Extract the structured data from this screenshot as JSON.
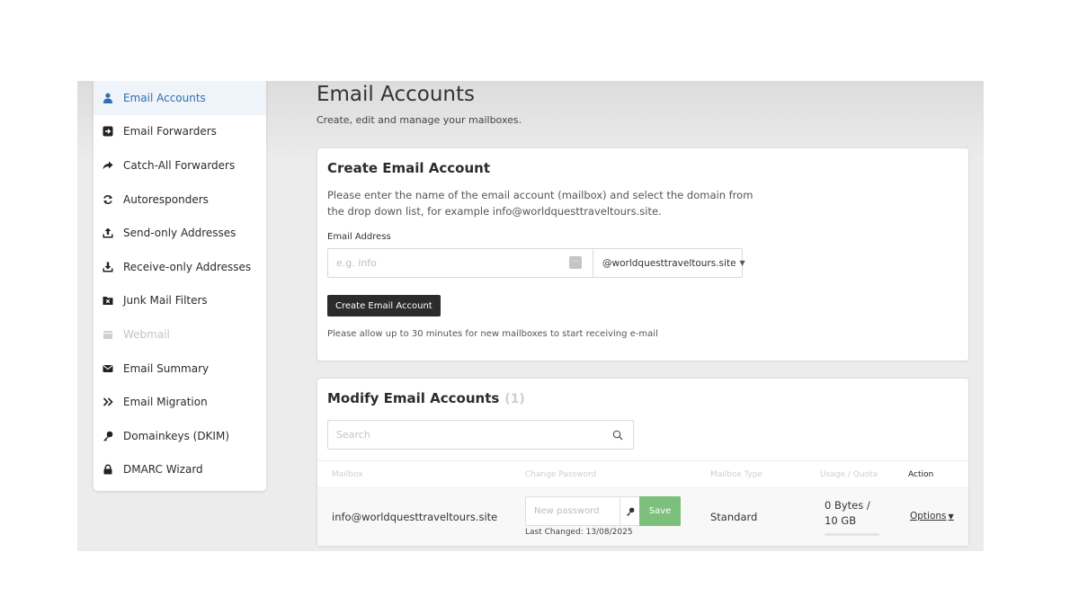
{
  "sidebar": {
    "items": [
      {
        "label": "Email Accounts",
        "icon": "user-icon",
        "active": true,
        "disabled": false
      },
      {
        "label": "Email Forwarders",
        "icon": "forward-box-icon",
        "active": false,
        "disabled": false
      },
      {
        "label": "Catch-All Forwarders",
        "icon": "share-icon",
        "active": false,
        "disabled": false
      },
      {
        "label": "Autoresponders",
        "icon": "refresh-icon",
        "active": false,
        "disabled": false
      },
      {
        "label": "Send-only Addresses",
        "icon": "upload-icon",
        "active": false,
        "disabled": false
      },
      {
        "label": "Receive-only Addresses",
        "icon": "download-icon",
        "active": false,
        "disabled": false
      },
      {
        "label": "Junk Mail Filters",
        "icon": "folder-x-icon",
        "active": false,
        "disabled": false
      },
      {
        "label": "Webmail",
        "icon": "calendar-icon",
        "active": false,
        "disabled": true
      },
      {
        "label": "Email Summary",
        "icon": "envelope-icon",
        "active": false,
        "disabled": false
      },
      {
        "label": "Email Migration",
        "icon": "double-chevron-icon",
        "active": false,
        "disabled": false
      },
      {
        "label": "Domainkeys (DKIM)",
        "icon": "key-icon",
        "active": false,
        "disabled": false
      },
      {
        "label": "DMARC Wizard",
        "icon": "lock-icon",
        "active": false,
        "disabled": false
      }
    ]
  },
  "header": {
    "title": "Email Accounts",
    "subtitle": "Create, edit and manage your mailboxes."
  },
  "create": {
    "title": "Create Email Account",
    "description": "Please enter the name of the email account (mailbox) and select the domain from the drop down list, for example info@worldquesttraveltours.site.",
    "email_label": "Email Address",
    "email_placeholder": "e.g. info",
    "pw_manager_glyph": "···",
    "domain": "@worldquesttraveltours.site",
    "button": "Create Email Account",
    "note": "Please allow up to 30 minutes for new mailboxes to start receiving e-mail"
  },
  "modify": {
    "title": "Modify Email Accounts",
    "count": "(1)",
    "search_placeholder": "Search",
    "columns": {
      "mailbox": "Mailbox",
      "change_password": "Change Password",
      "mailbox_type": "Mailbox Type",
      "usage_quota": "Usage / Quota",
      "action": "Action"
    },
    "rows": [
      {
        "mailbox": "info@worldquesttraveltours.site",
        "password_placeholder": "New password",
        "save": "Save",
        "last_changed": "Last Changed: 13/08/2025",
        "type": "Standard",
        "usage_line1": "0 Bytes /",
        "usage_line2": "10 GB",
        "usage_fraction": 0,
        "options": "Options"
      }
    ]
  },
  "colors": {
    "active_item_bg": "#eef4fa",
    "active_item_text": "#2f6fad",
    "save_button": "#7cc07c",
    "create_button": "#2b2b2b"
  }
}
